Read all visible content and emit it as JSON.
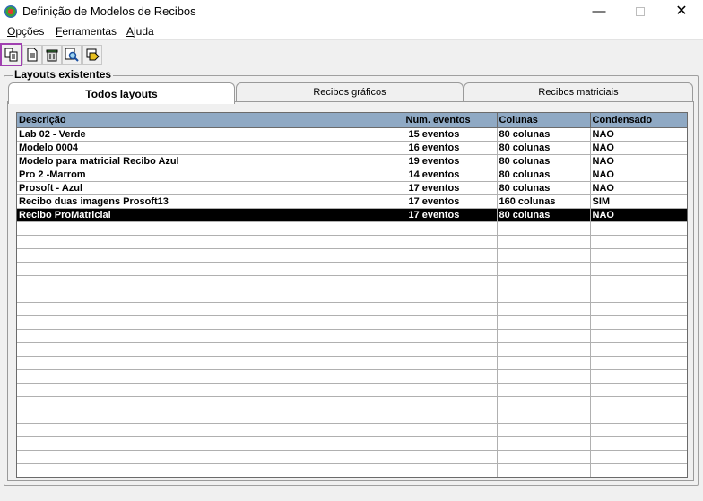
{
  "window": {
    "title": "Definição de Modelos de Recibos",
    "min": "—",
    "close": "✕"
  },
  "menu": [
    {
      "label": "Opções",
      "u": "O"
    },
    {
      "label": "Ferramentas",
      "u": "F"
    },
    {
      "label": "Ajuda",
      "u": "A"
    }
  ],
  "group": {
    "label": "Layouts existentes"
  },
  "tabs": [
    "Todos layouts",
    "Recibos gráficos",
    "Recibos matriciais"
  ],
  "table": {
    "headers": [
      "Descrição",
      "Num. eventos",
      "Colunas",
      "Condensado"
    ],
    "rows": [
      [
        "Lab 02 - Verde",
        "15 eventos",
        "80 colunas",
        "NAO"
      ],
      [
        "Modelo 0004",
        "16 eventos",
        "80 colunas",
        "NAO"
      ],
      [
        "Modelo para matricial Recibo Azul",
        "19 eventos",
        "80 colunas",
        "NAO"
      ],
      [
        "Pro 2 -Marrom",
        "14 eventos",
        "80 colunas",
        "NAO"
      ],
      [
        "Prosoft - Azul",
        "17 eventos",
        "80 colunas",
        "NAO"
      ],
      [
        "Recibo duas imagens Prosoft13",
        "17 eventos",
        "160 colunas",
        "SIM"
      ],
      [
        "Recibo ProMatricial",
        "17 eventos",
        "80 colunas",
        "NAO"
      ]
    ],
    "selected_index": 6
  },
  "colors": {
    "header_bg": "#8fa9c4",
    "selection": "#000000",
    "highlight_border": "#a040b0"
  }
}
